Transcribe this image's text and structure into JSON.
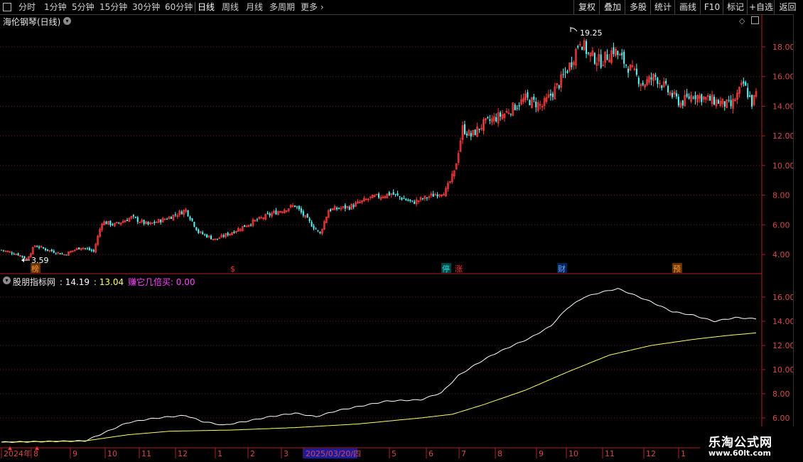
{
  "toolbar": {
    "periods": [
      "分时",
      "1分钟",
      "5分钟",
      "15分钟",
      "30分钟",
      "60分钟",
      "日线",
      "周线",
      "月线",
      "多周期",
      "更多"
    ],
    "active_period": "日线",
    "right_buttons": [
      "复权",
      "叠加",
      "多股",
      "统计",
      "画线",
      "F10",
      "标记",
      "+自选",
      "返回"
    ]
  },
  "stock": {
    "title": "海伦钢琴(日线)"
  },
  "main_chart": {
    "y_ticks": [
      "18.00",
      "16.00",
      "14.00",
      "12.00",
      "10.00",
      "8.00",
      "6.00",
      "4.00"
    ],
    "high_label": "19.25",
    "low_label": "3.59",
    "markers": [
      {
        "text": "榜",
        "color": "#ff9933",
        "bg": "#663300"
      },
      {
        "text": "$",
        "color": "#ff3333",
        "bg": ""
      },
      {
        "text": "停",
        "color": "#33dddd",
        "bg": "#004444"
      },
      {
        "text": "涨",
        "color": "#ff3333",
        "bg": ""
      },
      {
        "text": "财",
        "color": "#66aaff",
        "bg": "#002255"
      },
      {
        "text": "预",
        "color": "#ff9933",
        "bg": "#663300"
      }
    ]
  },
  "indicator": {
    "name": "股朋指标网",
    "value1": ": 14.19",
    "value2": ": 13.04",
    "label3": "赚它几倍买: 0.00",
    "y_ticks": [
      "16.00",
      "14.00",
      "12.00",
      "10.00",
      "8.00",
      "6.00"
    ]
  },
  "date_axis": {
    "labels": [
      "2024年",
      "8",
      "9",
      "10",
      "11",
      "12",
      "1",
      "2",
      "3",
      "2025/03/20/四",
      "5",
      "6",
      "7",
      "8",
      "9",
      "10",
      "11",
      "12",
      "1",
      "2"
    ]
  },
  "watermark": {
    "line1": "乐淘公式网",
    "line2": "www.60lt.com"
  },
  "colors": {
    "up": "#ff3c3c",
    "down": "#54ffff",
    "white_line": "#ffffff",
    "yellow_line": "#ffff66",
    "axis": "#b02020",
    "grid": "#7a1a1a"
  },
  "chart_data": {
    "type": "candlestick",
    "ylim": [
      3.0,
      19.8
    ],
    "y_ticks": [
      4,
      6,
      8,
      10,
      12,
      14,
      16,
      18
    ],
    "close_anchors": [
      [
        0,
        4.3
      ],
      [
        8,
        4.0
      ],
      [
        12,
        3.7
      ],
      [
        16,
        4.6
      ],
      [
        22,
        4.3
      ],
      [
        30,
        4.0
      ],
      [
        38,
        4.5
      ],
      [
        44,
        4.2
      ],
      [
        48,
        6.2
      ],
      [
        54,
        6.0
      ],
      [
        62,
        6.5
      ],
      [
        70,
        6.0
      ],
      [
        80,
        6.5
      ],
      [
        88,
        7.0
      ],
      [
        94,
        5.5
      ],
      [
        102,
        5.0
      ],
      [
        110,
        5.5
      ],
      [
        120,
        6.2
      ],
      [
        130,
        6.8
      ],
      [
        140,
        7.3
      ],
      [
        148,
        6.0
      ],
      [
        152,
        5.4
      ],
      [
        156,
        7.0
      ],
      [
        166,
        7.2
      ],
      [
        176,
        7.8
      ],
      [
        186,
        8.1
      ],
      [
        196,
        7.5
      ],
      [
        206,
        8.0
      ],
      [
        212,
        8.3
      ],
      [
        216,
        9.5
      ],
      [
        220,
        12.5
      ],
      [
        224,
        12.0
      ],
      [
        230,
        12.8
      ],
      [
        240,
        13.5
      ],
      [
        250,
        14.5
      ],
      [
        258,
        14.0
      ],
      [
        266,
        15.5
      ],
      [
        272,
        17.0
      ],
      [
        276,
        18.5
      ],
      [
        280,
        17.5
      ],
      [
        286,
        17.0
      ],
      [
        292,
        17.8
      ],
      [
        300,
        16.5
      ],
      [
        306,
        15.5
      ],
      [
        312,
        16.0
      ],
      [
        318,
        15.0
      ],
      [
        324,
        14.2
      ],
      [
        330,
        14.8
      ],
      [
        336,
        14.5
      ],
      [
        342,
        14.3
      ],
      [
        348,
        14.0
      ],
      [
        354,
        15.5
      ],
      [
        358,
        14.2
      ],
      [
        360,
        14.8
      ]
    ],
    "indicator_white_anchors": [
      [
        0,
        4.0
      ],
      [
        40,
        4.1
      ],
      [
        48,
        4.7
      ],
      [
        60,
        5.6
      ],
      [
        70,
        5.9
      ],
      [
        80,
        6.1
      ],
      [
        88,
        6.2
      ],
      [
        96,
        5.7
      ],
      [
        106,
        5.4
      ],
      [
        116,
        5.7
      ],
      [
        128,
        6.1
      ],
      [
        140,
        6.4
      ],
      [
        150,
        6.1
      ],
      [
        160,
        6.6
      ],
      [
        172,
        7.0
      ],
      [
        184,
        7.4
      ],
      [
        200,
        7.5
      ],
      [
        210,
        8.1
      ],
      [
        218,
        9.5
      ],
      [
        226,
        10.4
      ],
      [
        234,
        11.2
      ],
      [
        244,
        12.0
      ],
      [
        252,
        12.6
      ],
      [
        262,
        13.6
      ],
      [
        270,
        15.1
      ],
      [
        278,
        16.0
      ],
      [
        286,
        16.4
      ],
      [
        294,
        16.7
      ],
      [
        300,
        16.3
      ],
      [
        310,
        15.6
      ],
      [
        320,
        14.8
      ],
      [
        330,
        14.5
      ],
      [
        340,
        14.0
      ],
      [
        350,
        14.3
      ],
      [
        360,
        14.2
      ]
    ],
    "indicator_yellow_anchors": [
      [
        0,
        4.0
      ],
      [
        40,
        4.1
      ],
      [
        48,
        4.3
      ],
      [
        60,
        4.6
      ],
      [
        80,
        4.9
      ],
      [
        110,
        5.0
      ],
      [
        140,
        5.2
      ],
      [
        170,
        5.5
      ],
      [
        200,
        6.0
      ],
      [
        215,
        6.3
      ],
      [
        230,
        7.1
      ],
      [
        250,
        8.3
      ],
      [
        270,
        9.8
      ],
      [
        290,
        11.2
      ],
      [
        310,
        12.0
      ],
      [
        330,
        12.5
      ],
      [
        345,
        12.8
      ],
      [
        360,
        13.04
      ]
    ]
  }
}
